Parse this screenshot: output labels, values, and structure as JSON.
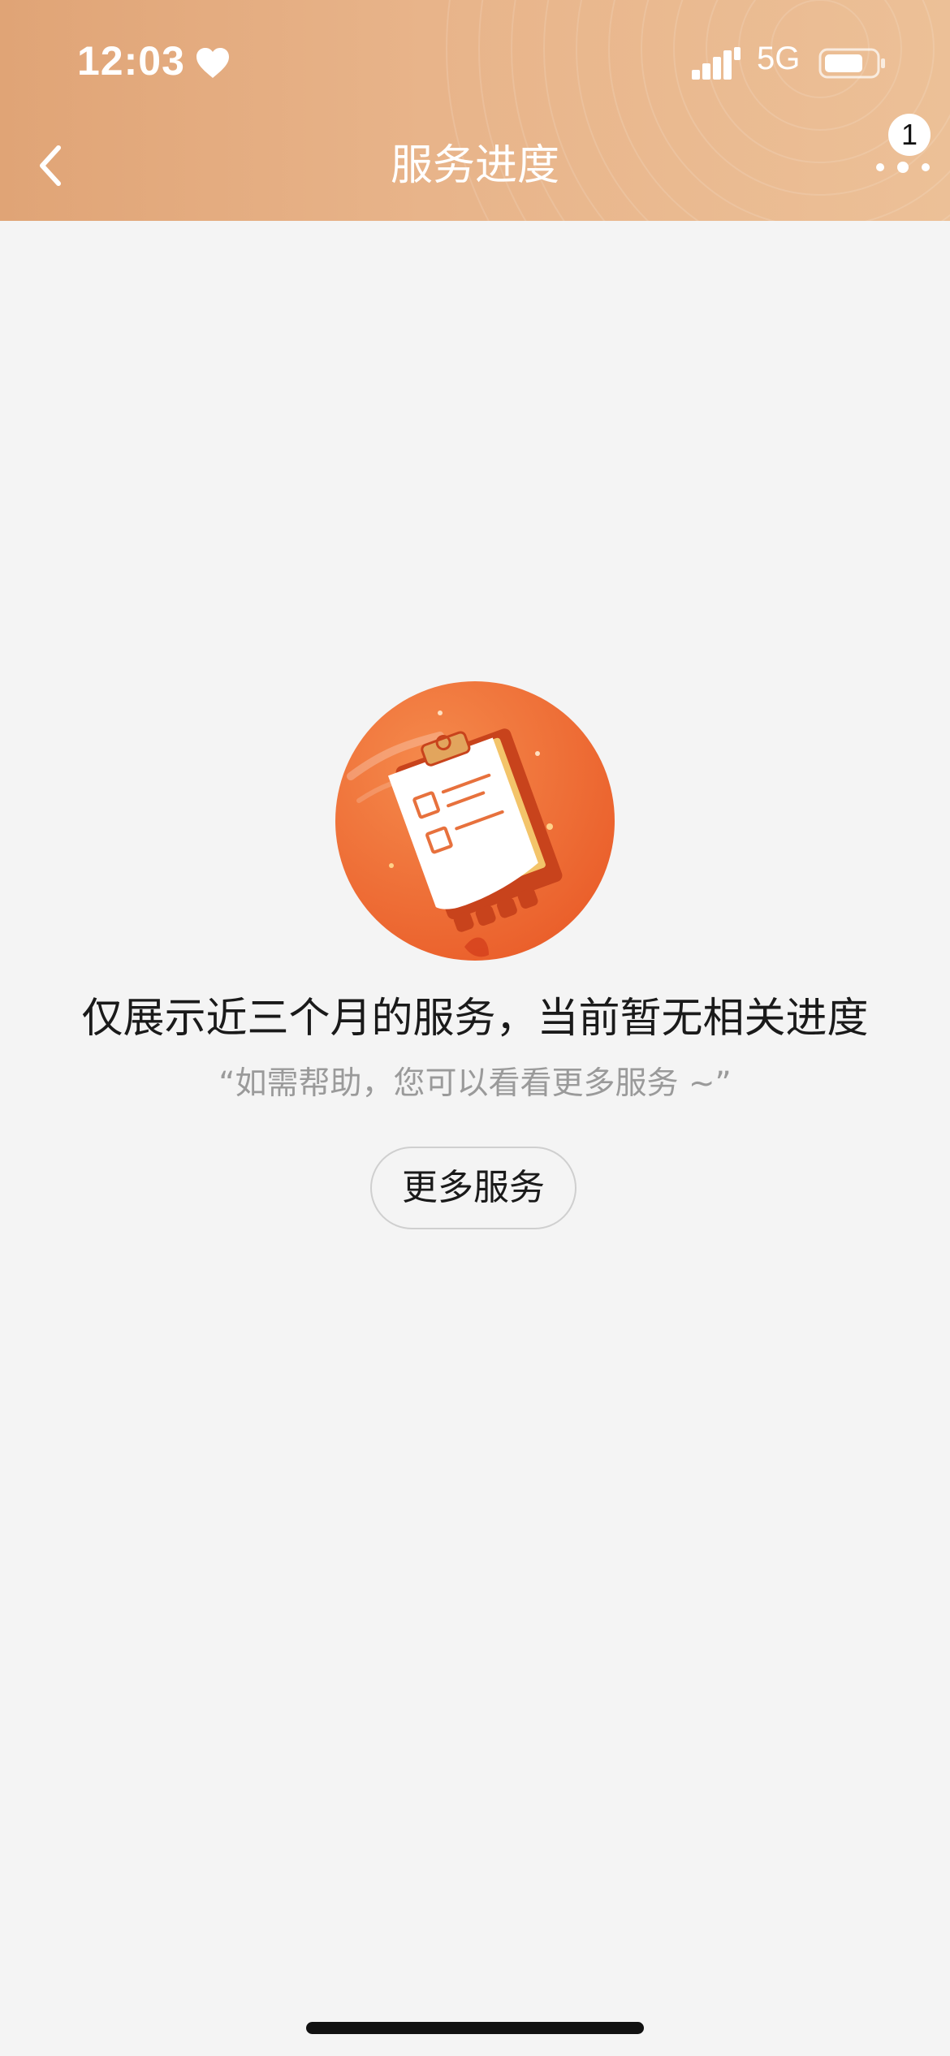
{
  "status_bar": {
    "time": "12:03",
    "network": "5G",
    "icons": [
      "heart-icon",
      "signal-icon",
      "battery-icon"
    ]
  },
  "header": {
    "title": "服务进度",
    "back_icon": "chevron-left-icon",
    "more_icon": "more-dots-icon",
    "badge_count": "1",
    "colors": {
      "start": "#e0a476",
      "end": "#ecc097"
    }
  },
  "empty_state": {
    "illustration": "clipboard-checklist-icon",
    "title": "仅展示近三个月的服务，当前暂无相关进度",
    "subtitle": "“如需帮助，您可以看看更多服务 ~”",
    "button_label": "更多服务",
    "accent_color": "#ee6a35"
  }
}
